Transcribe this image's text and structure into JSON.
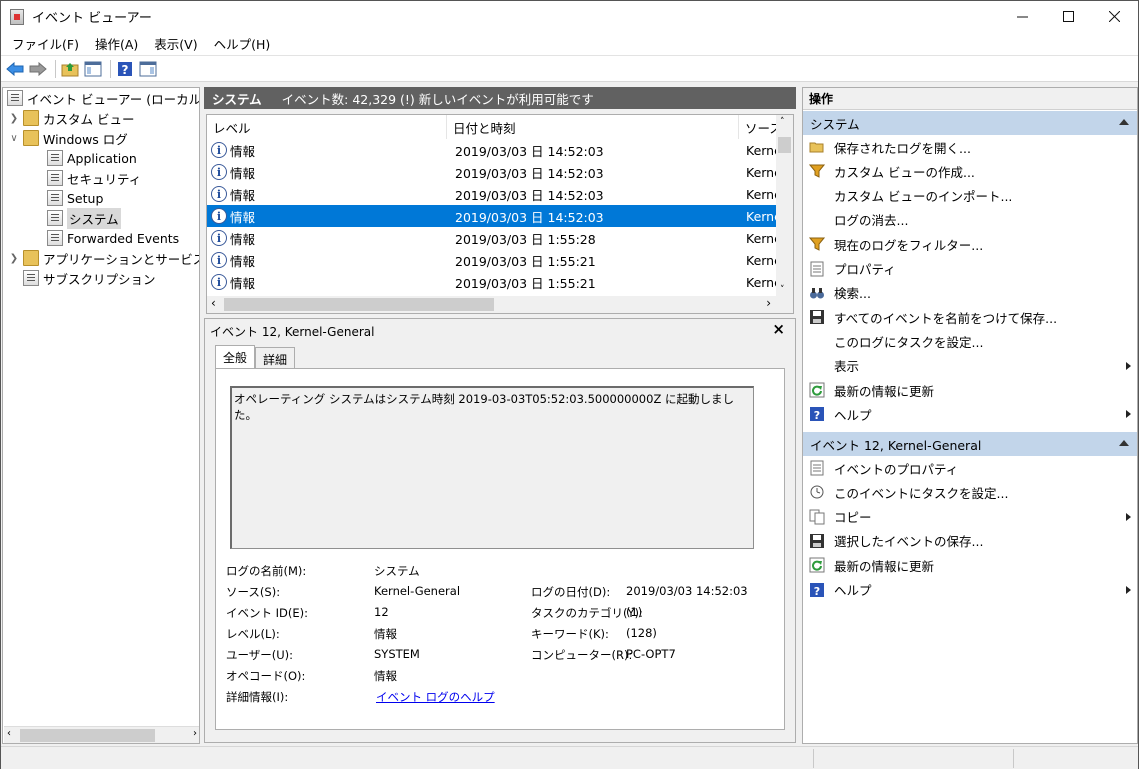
{
  "window": {
    "title": "イベント ビューアー"
  },
  "menu": {
    "file": "ファイル(F)",
    "action": "操作(A)",
    "view": "表示(V)",
    "help": "ヘルプ(H)"
  },
  "tree": {
    "root": "イベント ビューアー (ローカル)",
    "custom_views": "カスタム ビュー",
    "windows_logs": "Windows ログ",
    "application": "Application",
    "security": "セキュリティ",
    "setup": "Setup",
    "system": "システム",
    "forwarded": "Forwarded Events",
    "apps_services": "アプリケーションとサービス ログ",
    "subscriptions": "サブスクリプション"
  },
  "center": {
    "title": "システム",
    "summary": "イベント数: 42,329 (!) 新しいイベントが利用可能です",
    "columns": {
      "level": "レベル",
      "datetime": "日付と時刻",
      "source": "ソース"
    },
    "rows": [
      {
        "level": "情報",
        "datetime": "2019/03/03 日 14:52:03",
        "source": "Kernel-General"
      },
      {
        "level": "情報",
        "datetime": "2019/03/03 日 14:52:03",
        "source": "Kernel-General"
      },
      {
        "level": "情報",
        "datetime": "2019/03/03 日 14:52:03",
        "source": "Kernel-General"
      },
      {
        "level": "情報",
        "datetime": "2019/03/03 日 14:52:03",
        "source": "Kernel-General"
      },
      {
        "level": "情報",
        "datetime": "2019/03/03 日 1:55:28",
        "source": "Kernel-General"
      },
      {
        "level": "情報",
        "datetime": "2019/03/03 日 1:55:21",
        "source": "Kernel-General"
      },
      {
        "level": "情報",
        "datetime": "2019/03/03 日 1:55:21",
        "source": "Kernel-General"
      }
    ],
    "selected_row": 3
  },
  "detail": {
    "title": "イベント 12, Kernel-General",
    "tab_general": "全般",
    "tab_details": "詳細",
    "message": "オペレーティング システムはシステム時刻 2019-03-03T05:52:03.500000000Z に起動しました。",
    "labels": {
      "log_name": "ログの名前(M):",
      "source": "ソース(S):",
      "event_id": "イベント ID(E):",
      "level": "レベル(L):",
      "user": "ユーザー(U):",
      "opcode": "オペコード(O):",
      "more_info": "詳細情報(I):",
      "logged": "ログの日付(D):",
      "task_category": "タスクのカテゴリ(Y):",
      "keywords": "キーワード(K):",
      "computer": "コンピューター(R):"
    },
    "values": {
      "log_name": "システム",
      "source": "Kernel-General",
      "event_id": "12",
      "level": "情報",
      "user": "SYSTEM",
      "opcode": "情報",
      "more_info": "イベント ログのヘルプ",
      "logged": "2019/03/03  14:52:03",
      "task_category": "(1)",
      "keywords": "(128)",
      "computer": "PC-OPT7"
    }
  },
  "actions": {
    "header": "操作",
    "section1": "システム",
    "items1": [
      {
        "label": "保存されたログを開く...",
        "icon": "folder-open-icon",
        "arrow": false
      },
      {
        "label": "カスタム ビューの作成...",
        "icon": "filter-icon",
        "arrow": false
      },
      {
        "label": "カスタム ビューのインポート...",
        "icon": "",
        "arrow": false
      },
      {
        "label": "ログの消去...",
        "icon": "",
        "arrow": false
      },
      {
        "label": "現在のログをフィルター...",
        "icon": "filter-icon",
        "arrow": false
      },
      {
        "label": "プロパティ",
        "icon": "properties-icon",
        "arrow": false
      },
      {
        "label": "検索...",
        "icon": "binoculars-icon",
        "arrow": false
      },
      {
        "label": "すべてのイベントを名前をつけて保存...",
        "icon": "save-icon",
        "arrow": false
      },
      {
        "label": "このログにタスクを設定...",
        "icon": "",
        "arrow": false
      },
      {
        "label": "表示",
        "icon": "",
        "arrow": true
      },
      {
        "label": "最新の情報に更新",
        "icon": "refresh-icon",
        "arrow": false
      },
      {
        "label": "ヘルプ",
        "icon": "help-icon",
        "arrow": true
      }
    ],
    "section2": "イベント 12, Kernel-General",
    "items2": [
      {
        "label": "イベントのプロパティ",
        "icon": "properties-icon",
        "arrow": false
      },
      {
        "label": "このイベントにタスクを設定...",
        "icon": "task-icon",
        "arrow": false
      },
      {
        "label": "コピー",
        "icon": "copy-icon",
        "arrow": true
      },
      {
        "label": "選択したイベントの保存...",
        "icon": "save-icon",
        "arrow": false
      },
      {
        "label": "最新の情報に更新",
        "icon": "refresh-icon",
        "arrow": false
      },
      {
        "label": "ヘルプ",
        "icon": "help-icon",
        "arrow": true
      }
    ]
  },
  "colors": {
    "selection": "#0078d7",
    "section": "#c2d5ea",
    "center_header": "#616161"
  }
}
